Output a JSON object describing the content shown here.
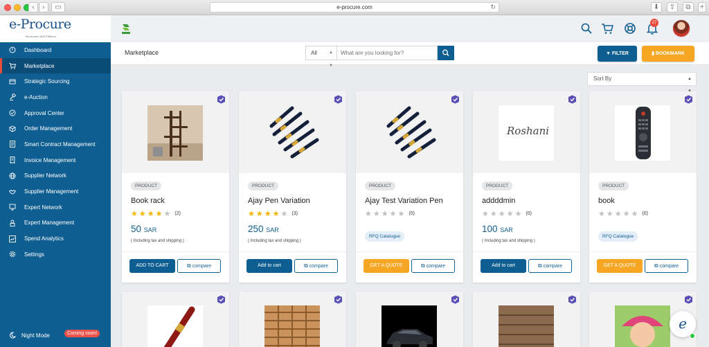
{
  "browser": {
    "url": "e-procure.com"
  },
  "brand": {
    "logo": "e-Procure",
    "tagline": "Blockchain B2B Platform"
  },
  "sidebar": {
    "items": [
      {
        "label": "Dashboard",
        "icon": "dashboard-icon"
      },
      {
        "label": "Marketplace",
        "icon": "cart-icon"
      },
      {
        "label": "Strategic Sourcing",
        "icon": "sourcing-icon"
      },
      {
        "label": "e-Auction",
        "icon": "auction-icon"
      },
      {
        "label": "Approval Center",
        "icon": "check-circle-icon"
      },
      {
        "label": "Order Management",
        "icon": "box-icon"
      },
      {
        "label": "Smart Contract Management",
        "icon": "contract-icon"
      },
      {
        "label": "Invoice Management",
        "icon": "invoice-icon"
      },
      {
        "label": "Supplier Network",
        "icon": "network-icon"
      },
      {
        "label": "Supplier Management",
        "icon": "handshake-icon"
      },
      {
        "label": "Expert Network",
        "icon": "expert-icon"
      },
      {
        "label": "Expert Management",
        "icon": "lock-user-icon"
      },
      {
        "label": "Spend Analytics",
        "icon": "analytics-icon"
      },
      {
        "label": "Settings",
        "icon": "gear-icon"
      }
    ],
    "active_index": 1,
    "night_mode": {
      "label": "Night Mode",
      "badge": "Coming soon!"
    }
  },
  "header": {
    "notifications": "27"
  },
  "subheader": {
    "breadcrumb": "Marketplace",
    "category": "All",
    "search_placeholder": "What are you looking for?",
    "filter_label": "FILTER",
    "bookmark_label": "BOOKMARK"
  },
  "sort": {
    "label": "Sort By"
  },
  "products": [
    {
      "tag": "PRODUCT",
      "title": "Book rack",
      "rating": 4,
      "count": "(2)",
      "price": "50",
      "currency": "SAR",
      "note": "( Including tax and shipping )",
      "action": "ADD TO CART",
      "compare": "compare"
    },
    {
      "tag": "PRODUCT",
      "title": "Ajay Pen Variation",
      "rating": 4,
      "count": "(3)",
      "price": "250",
      "currency": "SAR",
      "note": "( Including tax and shipping )",
      "action": "Add to cart",
      "compare": "compare"
    },
    {
      "tag": "PRODUCT",
      "title": "Ajay Test Variation Pen",
      "rating": 0,
      "count": "(0)",
      "rfq": "RFQ Catalogue",
      "action": "GET A QUOTE",
      "compare": "compare"
    },
    {
      "tag": "PRODUCT",
      "title": "addddmin",
      "rating": 0,
      "count": "(0)",
      "price": "100",
      "currency": "SAR",
      "note": "( Including tax and shipping )",
      "action": "Add to cart",
      "compare": "compare"
    },
    {
      "tag": "PRODUCT",
      "title": "book",
      "rating": 0,
      "count": "(0)",
      "rfq": "RFQ Catalogue",
      "action": "GET A QUOTE",
      "compare": "compare"
    }
  ],
  "thumb_text": {
    "signature": "Roshani"
  },
  "colors": {
    "primary": "#0f5e91",
    "accent": "#f5a623",
    "active_marker": "#e94b3c",
    "star": "#f5b301"
  }
}
